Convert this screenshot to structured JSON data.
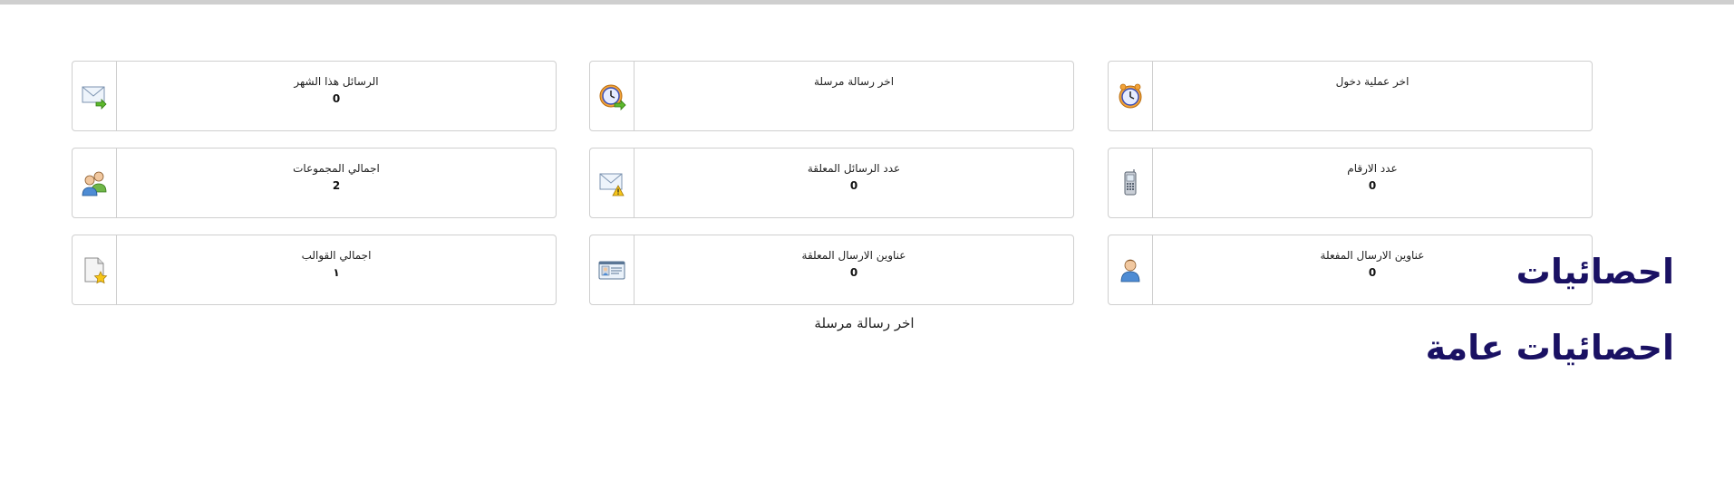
{
  "headings": {
    "stats": "احصائيات",
    "general_stats": "احصائيات عامة"
  },
  "caption": "اخر رسالة مرسلة",
  "cards": [
    {
      "label": "اخر عملية دخول",
      "value": "",
      "icon": "alarm-clock-icon"
    },
    {
      "label": "اخر رسالة مرسلة",
      "value": "",
      "icon": "clock-arrow-icon"
    },
    {
      "label": "الرسائل هذا الشهر",
      "value": "0",
      "icon": "mail-arrow-icon"
    },
    {
      "label": "عدد الارقام",
      "value": "0",
      "icon": "mobile-phone-icon"
    },
    {
      "label": "عدد الرسائل المعلقة",
      "value": "0",
      "icon": "mail-warning-icon"
    },
    {
      "label": "اجمالي المجموعات",
      "value": "2",
      "icon": "users-group-icon"
    },
    {
      "label": "عناوين الارسال المفعلة",
      "value": "0",
      "icon": "user-icon"
    },
    {
      "label": "عناوين الارسال المعلقة",
      "value": "0",
      "icon": "id-card-icon"
    },
    {
      "label": "اجمالي القوالب",
      "value": "١",
      "icon": "document-star-icon"
    }
  ],
  "colors": {
    "heading": "#1a1163",
    "border": "#cfcfcf",
    "top_bar": "#cfcfcf"
  }
}
